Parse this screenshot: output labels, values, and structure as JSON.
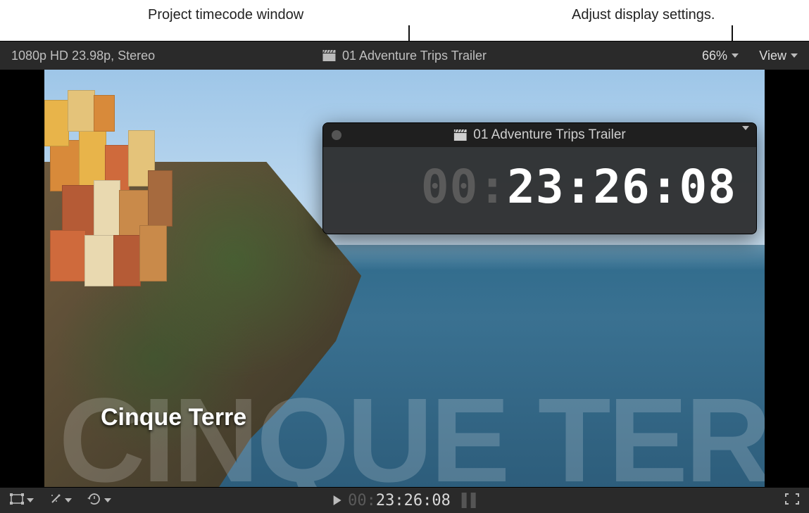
{
  "callouts": {
    "left": "Project timecode window",
    "right": "Adjust display settings."
  },
  "topbar": {
    "format": "1080p HD 23.98p, Stereo",
    "project_name": "01 Adventure Trips Trailer",
    "zoom": "66%",
    "view_label": "View"
  },
  "timecode_window": {
    "title": "01 Adventure Trips Trailer",
    "tc_dim": "00:",
    "tc_value": "23:26:08"
  },
  "overlay": {
    "title_small": "Cinque Terre",
    "title_big": "CINQUE TERRE"
  },
  "bottombar": {
    "tc_dim": "00:",
    "tc_value": "23:26:08"
  },
  "icons": {
    "clapper": "clapper-icon",
    "chevron": "chevron-down-icon",
    "transform": "transform-icon",
    "wand": "wand-icon",
    "retime": "retime-icon",
    "fullscreen": "fullscreen-icon",
    "play": "play-icon",
    "pause": "pause-indicator"
  }
}
